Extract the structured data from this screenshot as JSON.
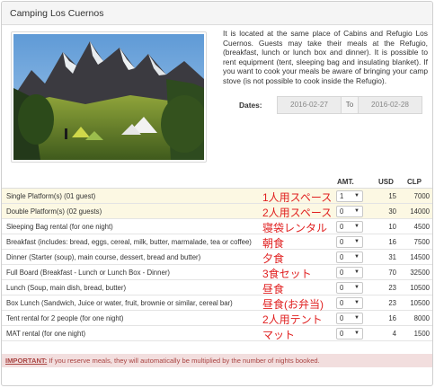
{
  "panel": {
    "title": "Camping Los Cuernos"
  },
  "description": "It is located at the same place of Cabins and Refugio Los Cuernos. Guests may take their meals at the Refugio, (breakfast, lunch or lunch box and dinner). It is possible to rent equipment (tent, sleeping bag and insulating blanket). If you want to cook your meals be aware of bringing your camp stove (is not possible to cook inside the Refugio).",
  "dates": {
    "label": "Dates:",
    "from": "2016-02-27",
    "to_label": "To",
    "to": "2016-02-28"
  },
  "table": {
    "headers": {
      "amt": "AMT.",
      "usd": "USD",
      "clp": "CLP"
    },
    "rows": [
      {
        "name": "Single Platform(s) (01 guest)",
        "jp": "1人用スペース",
        "amt": "1",
        "usd": "15",
        "clp": "7000"
      },
      {
        "name": "Double Platform(s) (02 guests)",
        "jp": "2人用スペース",
        "amt": "0",
        "usd": "30",
        "clp": "14000"
      },
      {
        "name": "Sleeping Bag rental (for one night)",
        "jp": "寝袋レンタル",
        "amt": "0",
        "usd": "10",
        "clp": "4500"
      },
      {
        "name": "Breakfast (includes: bread, eggs, cereal, milk, butter, marmalade, tea or coffee)",
        "jp": "朝食",
        "amt": "0",
        "usd": "16",
        "clp": "7500"
      },
      {
        "name": "Dinner (Starter (soup), main course, dessert, bread and butter)",
        "jp": "夕食",
        "amt": "0",
        "usd": "31",
        "clp": "14500"
      },
      {
        "name": "Full Board (Breakfast - Lunch or Lunch Box - Dinner)",
        "jp": "3食セット",
        "amt": "0",
        "usd": "70",
        "clp": "32500"
      },
      {
        "name": "Lunch (Soup, main dish, bread, butter)",
        "jp": "昼食",
        "amt": "0",
        "usd": "23",
        "clp": "10500"
      },
      {
        "name": "Box Lunch (Sandwich, Juice or water, fruit, brownie or similar, cereal bar)",
        "jp": "昼食(お弁当)",
        "amt": "0",
        "usd": "23",
        "clp": "10500"
      },
      {
        "name": "Tent rental for 2 people (for one night)",
        "jp": "2人用テント",
        "amt": "0",
        "usd": "16",
        "clp": "8000"
      },
      {
        "name": "MAT rental (for one night)",
        "jp": "マット",
        "amt": "0",
        "usd": "4",
        "clp": "1500"
      }
    ]
  },
  "notice": {
    "strong": "IMPORTANT:",
    "text": " If you reserve meals, they will automatically be multiplied by the number of nights booked."
  },
  "colors": {
    "highlight_row": "#fcf8e3",
    "annotation": "#e02020",
    "notice_bg": "#f2dede",
    "notice_text": "#a94442"
  }
}
